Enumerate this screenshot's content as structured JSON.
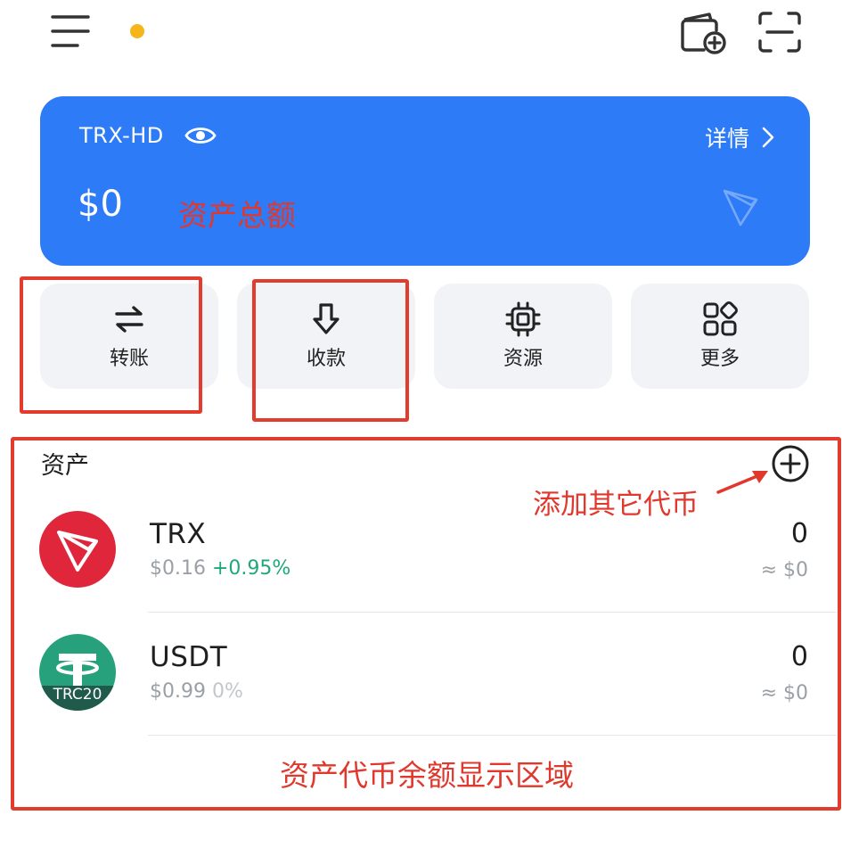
{
  "wallet": {
    "name": "TRX-HD",
    "details_label": "详情",
    "balance": "$0"
  },
  "actions": [
    {
      "label": "转账",
      "icon": "transfer-icon"
    },
    {
      "label": "收款",
      "icon": "receive-icon"
    },
    {
      "label": "资源",
      "icon": "chip-icon"
    },
    {
      "label": "更多",
      "icon": "grid-icon"
    }
  ],
  "assets": {
    "title": "资产",
    "tokens": [
      {
        "symbol": "TRX",
        "price": "$0.16",
        "change": "+0.95%",
        "amount": "0",
        "fiat": "≈ $0",
        "logo_color": "#e0263a"
      },
      {
        "symbol": "USDT",
        "price": "$0.99",
        "change": "0%",
        "amount": "0",
        "fiat": "≈ $0",
        "logo_color": "#26a17b",
        "badge": "TRC20"
      }
    ]
  },
  "annotations": {
    "total_assets": "资产总额",
    "add_token": "添加其它代币",
    "balance_area": "资产代币余额显示区域"
  },
  "colors": {
    "card": "#2d7bf6",
    "notification_dot": "#f5b51b",
    "positive_change": "#1fa87a",
    "annotation_red": "#e33b2e"
  }
}
